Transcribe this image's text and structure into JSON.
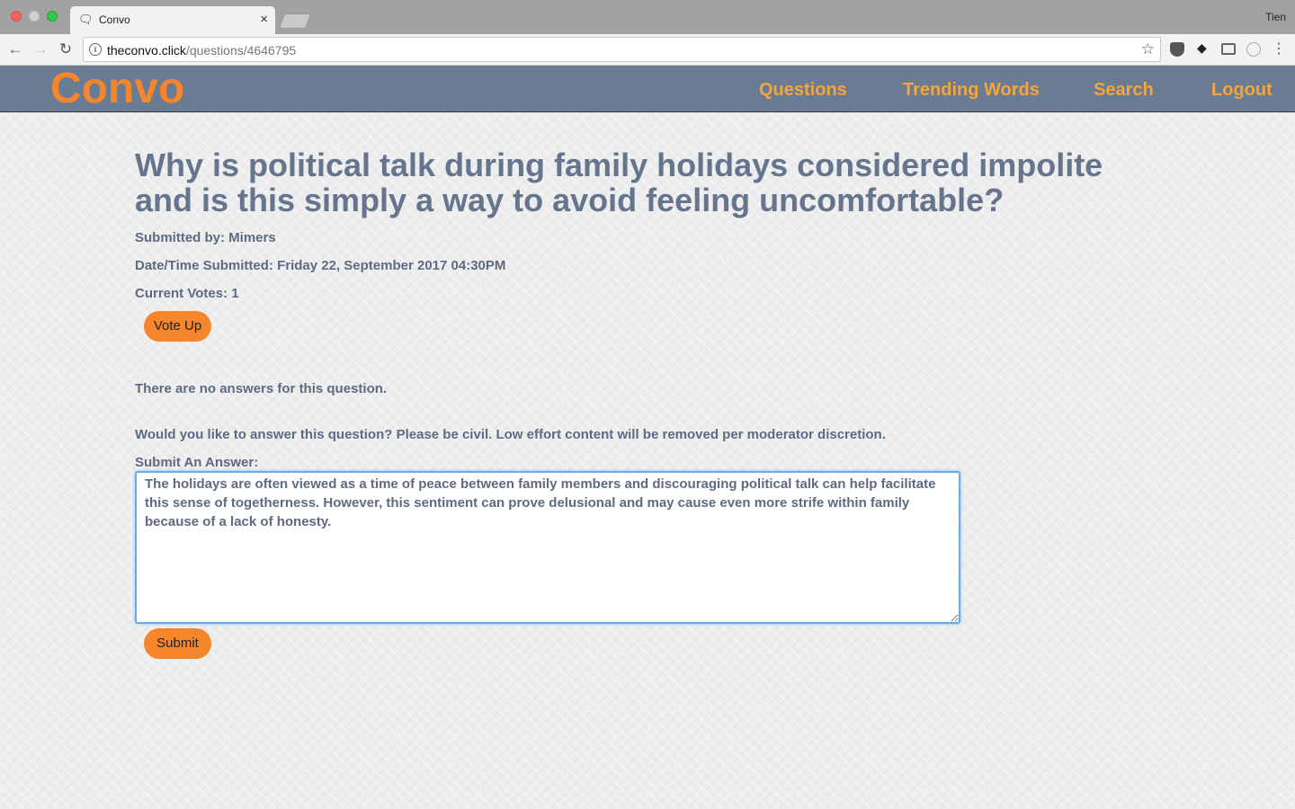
{
  "browser": {
    "tab_title": "Convo",
    "tab_close": "×",
    "profile_name": "Tien",
    "url_host": "theconvo.click",
    "url_path": "/questions/4646795"
  },
  "site": {
    "logo": "Convo",
    "nav": {
      "questions": "Questions",
      "trending": "Trending Words",
      "search": "Search",
      "logout": "Logout"
    },
    "colors": {
      "header_bg": "#6a7b94",
      "accent": "#f5862b",
      "text": "#5e6a82"
    }
  },
  "question": {
    "title": "Why is political talk during family holidays considered impolite and is this simply a way to avoid feeling uncomfortable?",
    "submitted_by": "Submitted by: Mimers",
    "submitted_at": "Date/Time Submitted: Friday 22, September 2017 04:30PM",
    "votes": "Current Votes: 1",
    "vote_button": "Vote Up"
  },
  "answers": {
    "empty_message": "There are no answers for this question.",
    "prompt": "Would you like to answer this question? Please be civil. Low effort content will be removed per moderator discretion.",
    "form_label": "Submit An Answer:",
    "draft_value": "The holidays are often viewed as a time of peace between family members and discouraging political talk can help facilitate this sense of togetherness. However, this sentiment can prove delusional and may cause even more strife within family because of a lack of honesty.",
    "submit_button": "Submit"
  }
}
